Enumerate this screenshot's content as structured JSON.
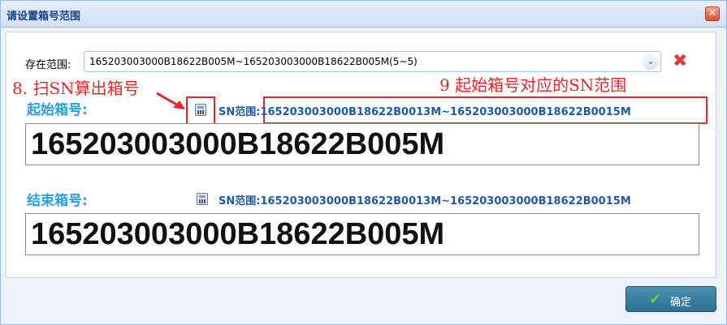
{
  "dialog": {
    "title": "请设置箱号范围",
    "close_symbol": "✕"
  },
  "range": {
    "label": "存在范围:",
    "value": "165203003000B18622B005M~165203003000B18622B005M(5~5)",
    "dropdown_symbol": "⌄",
    "delete_symbol": "✖"
  },
  "annotations": {
    "note8": "8.  扫SN算出箱号",
    "note9": "9  起始箱号对应的SN范围"
  },
  "start": {
    "label": "起始箱号:",
    "sn_range": "SN范围:165203003000B18622B0013M~165203003000B18622B0015M",
    "value": "165203003000B18622B005M"
  },
  "end": {
    "label": "结束箱号:",
    "sn_range": "SN范围:165203003000B18622B0013M~165203003000B18622B0015M",
    "value": "165203003000B18622B005M"
  },
  "footer": {
    "ok_label": "确定",
    "ok_icon": "✔"
  },
  "colors": {
    "accent": "#2aa1e0",
    "annotation_red": "#e8242a",
    "sn_blue": "#1d5aa8",
    "button": "#2e6f94"
  }
}
